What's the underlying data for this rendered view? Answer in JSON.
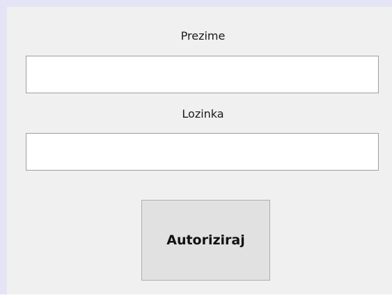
{
  "form": {
    "surname_label": "Prezime",
    "surname_value": "",
    "password_label": "Lozinka",
    "password_value": "",
    "authorize_button_label": "Autoriziraj"
  },
  "colors": {
    "window_frame": "#e4e4f6",
    "panel_background": "#f0f0f0",
    "button_background": "#e1e1e1",
    "input_border": "#9e9e9e"
  }
}
